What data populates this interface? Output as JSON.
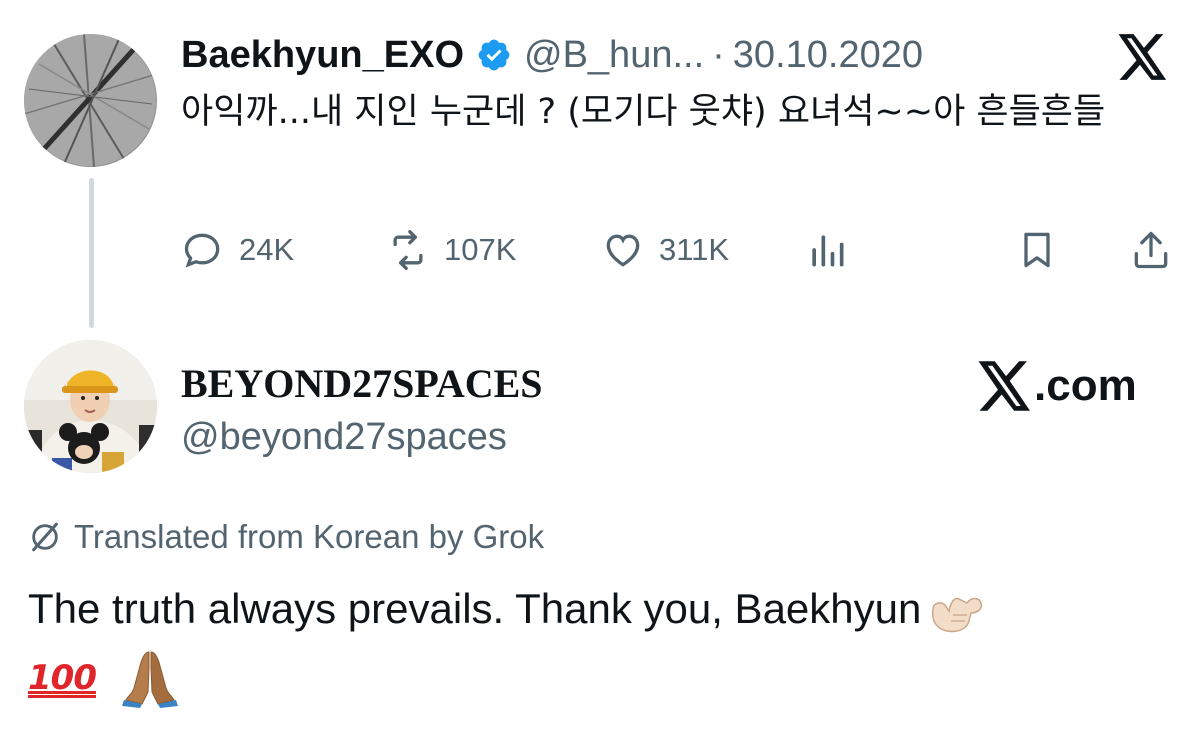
{
  "parent_tweet": {
    "display_name": "Baekhyun_EXO",
    "verified": true,
    "handle": "@B_hun...",
    "separator": "·",
    "date": "30.10.2020",
    "text": "아익까...내 지인 누군데 ? (모기다 웃챠) 요녀석~~아 흔들흔들",
    "stats": {
      "replies": "24K",
      "reposts": "107K",
      "likes": "311K"
    },
    "icons": [
      "reply-icon",
      "repost-icon",
      "like-icon",
      "views-icon",
      "bookmark-icon",
      "share-icon"
    ]
  },
  "reply": {
    "display_name": "BEYOND27SPACES",
    "handle": "@beyond27spaces",
    "brand": ".com",
    "translated_label": "Translated from Korean by Grok",
    "text": "The truth always prevails. Thank you, Baekhyun",
    "emoji_100": "100"
  },
  "colors": {
    "text_primary": "#0f1419",
    "text_secondary": "#536471",
    "verified_blue": "#1d9bf0",
    "thread_line": "#cfd9de"
  }
}
